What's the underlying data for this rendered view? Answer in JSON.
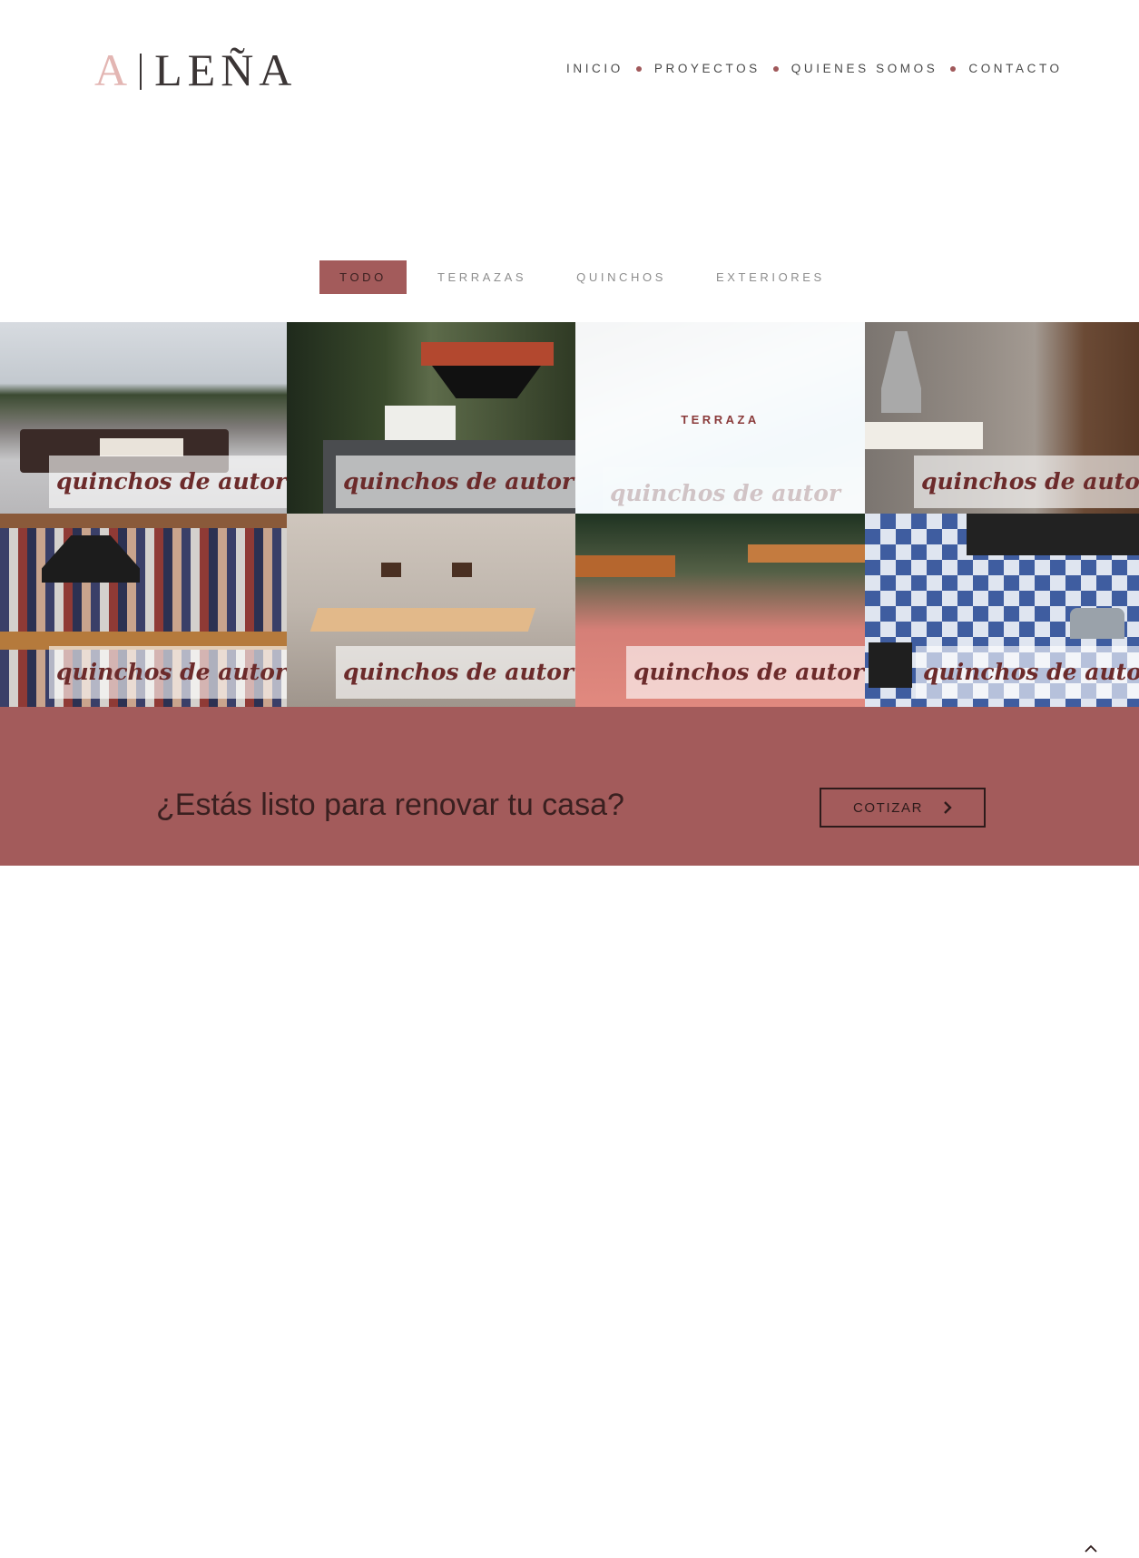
{
  "brand": {
    "logo_a": "A",
    "logo_rest": "LEÑA"
  },
  "nav": {
    "items": [
      "INICIO",
      "PROYECTOS",
      "QUIENES SOMOS",
      "CONTACTO"
    ]
  },
  "filters": {
    "items": [
      "TODO",
      "TERRAZAS",
      "QUINCHOS",
      "EXTERIORES"
    ],
    "active": "TODO"
  },
  "gallery": {
    "tile_caption": "quinchos de autor",
    "hover_category": "TERRAZA",
    "tiles": [
      {
        "caption": "quinchos de autor"
      },
      {
        "caption": "quinchos de autor"
      },
      {
        "caption": "quinchos de autor",
        "category": "TERRAZA"
      },
      {
        "caption": "quinchos de autor"
      },
      {
        "caption": "quinchos de autor"
      },
      {
        "caption": "quinchos de autor"
      },
      {
        "caption": "quinchos de autor"
      },
      {
        "caption": "quinchos de autor"
      }
    ]
  },
  "cta": {
    "question": "¿Estás listo para renovar tu casa?",
    "button_label": "COTIZAR"
  },
  "icons": {
    "cta_button": "chevron-right-icon",
    "scroll_top": "chevron-up-icon"
  },
  "colors": {
    "accent": "#a35b5b",
    "logo_a": "#e3b6b3",
    "text_dark": "#3b3535",
    "caption": "#6c2b2b"
  }
}
